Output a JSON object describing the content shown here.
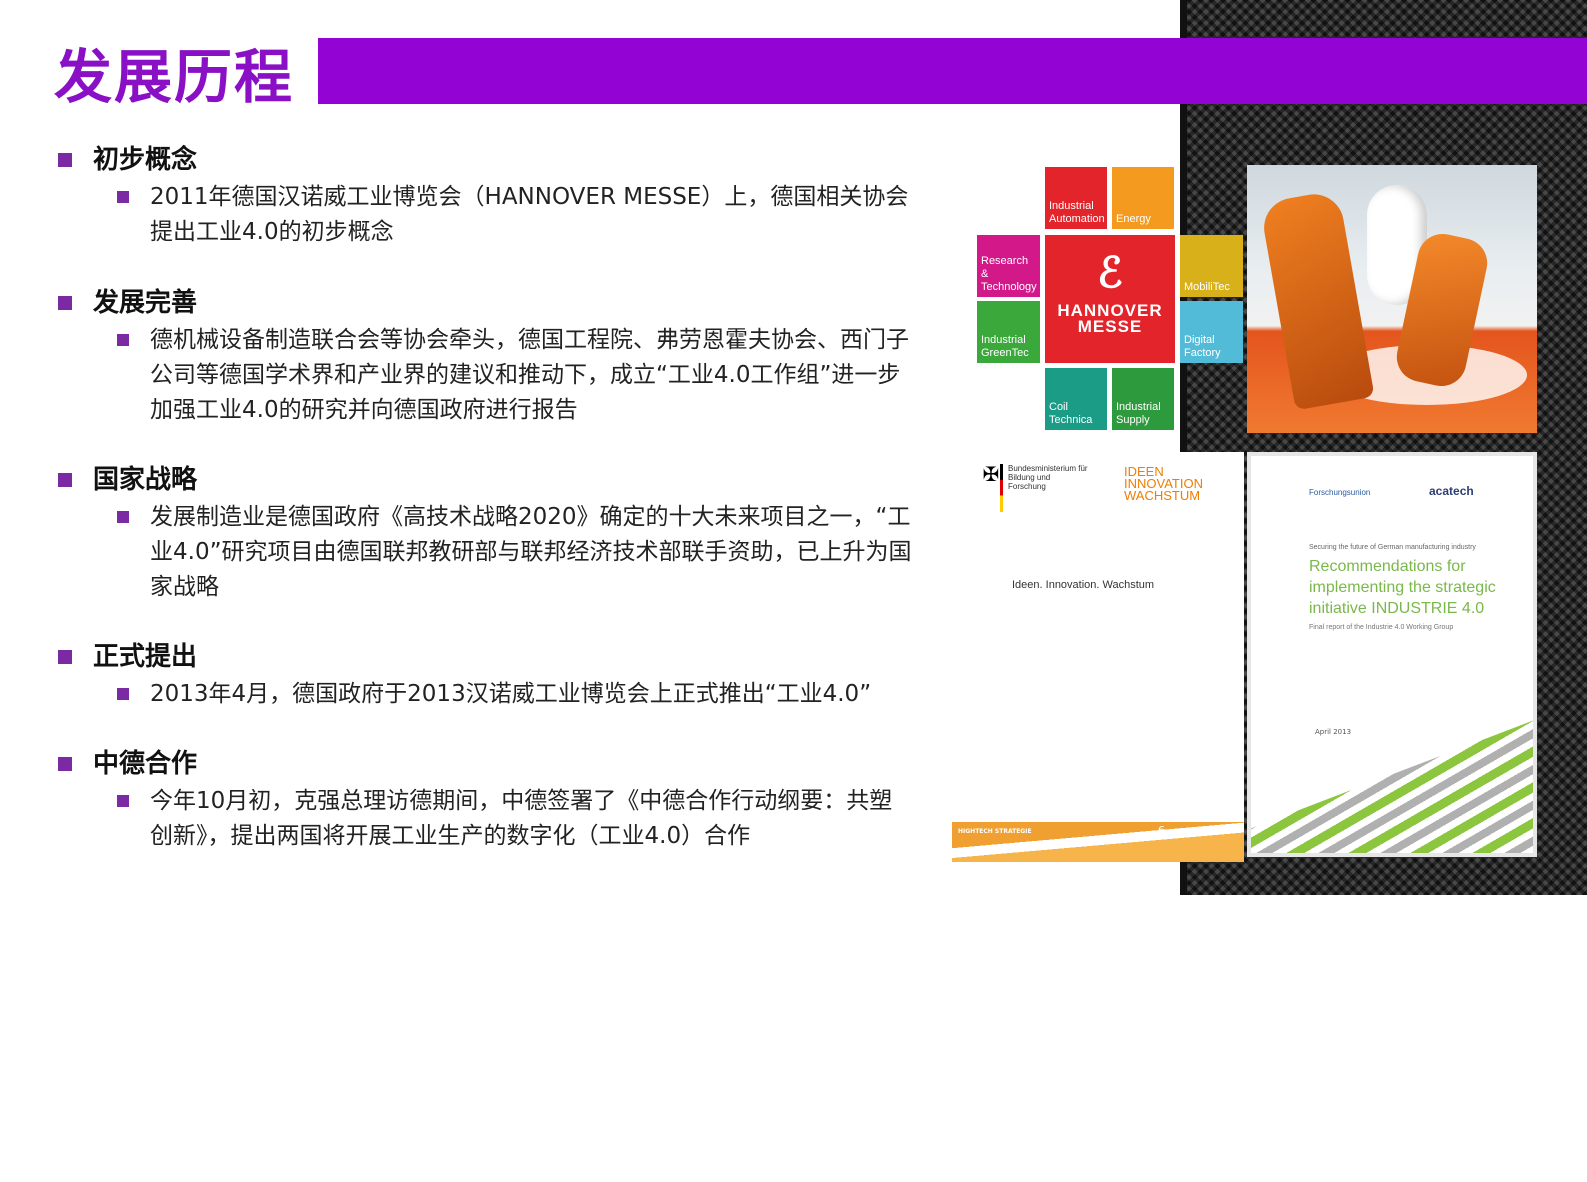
{
  "title": "发展历程",
  "colors": {
    "accent": "#9303d4",
    "bullet": "#7b2aa3"
  },
  "sections": [
    {
      "heading": "初步概念",
      "body": "2011年德国汉诺威工业博览会（HANNOVER MESSE）上，德国相关协会提出工业4.0的初步概念"
    },
    {
      "heading": "发展完善",
      "body": "德机械设备制造联合会等协会牵头，德国工程院、弗劳恩霍夫协会、西门子公司等德国学术界和产业界的建议和推动下，成立“工业4.0工作组”进一步加强工业4.0的研究并向德国政府进行报告"
    },
    {
      "heading": "国家战略",
      "body": "发展制造业是德国政府《高技术战略2020》确定的十大未来项目之一，“工业4.0”研究项目由德国联邦教研部与联邦经济技术部联手资助，已上升为国家战略"
    },
    {
      "heading": "正式提出",
      "body": "2013年4月，德国政府于2013汉诺威工业博览会上正式推出“工业4.0”"
    },
    {
      "heading": "中德合作",
      "body": "今年10月初，克强总理访德期间，中德签署了《中德合作行动纲要：共塑创新》，提出两国将开展工业生产的数字化（工业4.0）合作"
    }
  ],
  "hannover": {
    "center_line1": "HANNOVER",
    "center_line2": "MESSE",
    "tiles": [
      {
        "label": "Industrial Automation",
        "color": "#e3242b"
      },
      {
        "label": "Energy",
        "color": "#f39a1f"
      },
      {
        "label": "Research & Technology",
        "color": "#d3198a"
      },
      {
        "label": "MobiliTec",
        "color": "#d8b01a"
      },
      {
        "label": "Industrial GreenTec",
        "color": "#3aa83a"
      },
      {
        "label": "Digital Factory",
        "color": "#52bcd8"
      },
      {
        "label": "Coil Technica",
        "color": "#1b9c86"
      },
      {
        "label": "Industrial Supply",
        "color": "#2e9a3e"
      }
    ]
  },
  "doc1": {
    "ministry": "Bundesministerium für Bildung und Forschung",
    "ideen_logo": "IDEEN INNOVATION WACHSTUM",
    "main_title": "Ideen. Innovation. Wachstum",
    "band_left": "HIGHTECH STRATEGIE",
    "band_page": "6"
  },
  "doc2": {
    "logo_left": "Forschungsunion",
    "logo_right": "acatech",
    "kicker": "Securing the future of German manufacturing industry",
    "headline": "Recommendations for implementing the strategic initiative INDUSTRIE 4.0",
    "subline": "Final report of the Industrie 4.0 Working Group",
    "date": "April 2013"
  }
}
